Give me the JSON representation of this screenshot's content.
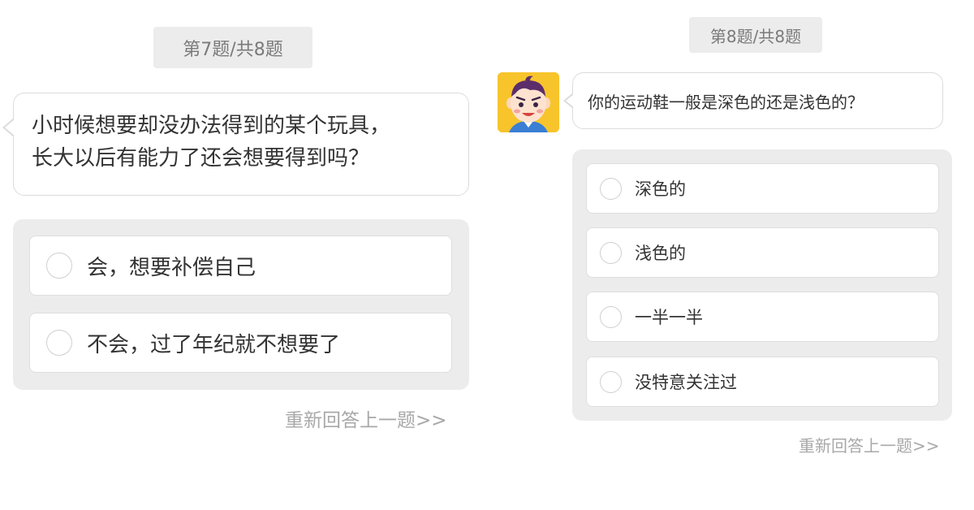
{
  "left_card": {
    "progress_badge": "第7题/共8题",
    "question_lines": [
      "小时候想要却没办法得到的某个玩具，",
      "长大以后有能力了还会想要得到吗？"
    ],
    "options": [
      "会，想要补偿自己",
      "不会，过了年纪就不想要了"
    ],
    "back_link": "重新回答上一题>>"
  },
  "right_card": {
    "progress_badge": "第8题/共8题",
    "avatar_icon": "cartoon-boy-avatar-icon",
    "question": "你的运动鞋一般是深色的还是浅色的？",
    "options": [
      "深色的",
      "浅色的",
      "一半一半",
      "没特意关注过"
    ],
    "back_link": "重新回答上一题>>"
  },
  "colors": {
    "badge_bg": "#ececec",
    "panel_bg": "#ececec",
    "avatar_bg": "#f8c42c",
    "link_text": "#a8a8a8"
  }
}
